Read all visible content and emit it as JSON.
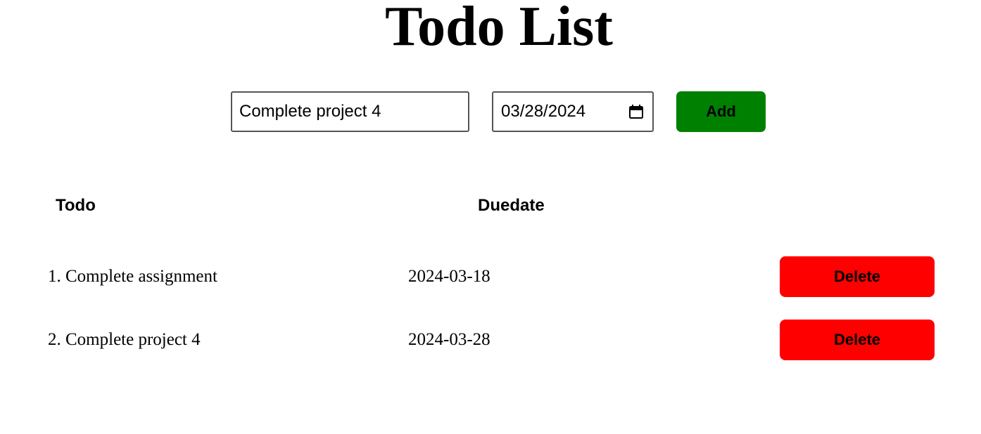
{
  "page": {
    "title": "Todo List"
  },
  "form": {
    "todo_value": "Complete project 4",
    "date_value": "03/28/2024",
    "add_label": "Add",
    "add_color": "#008000"
  },
  "table": {
    "headers": [
      "Todo",
      "Duedate"
    ],
    "rows": [
      {
        "index": "1.",
        "name": "Complete assignment",
        "due": "2024-03-18",
        "action": "Delete"
      },
      {
        "index": "2.",
        "name": "Complete project 4",
        "due": "2024-03-28",
        "action": "Delete"
      }
    ],
    "delete_color": "#ff0000"
  },
  "icons": {
    "date_picker": "calendar-icon"
  }
}
